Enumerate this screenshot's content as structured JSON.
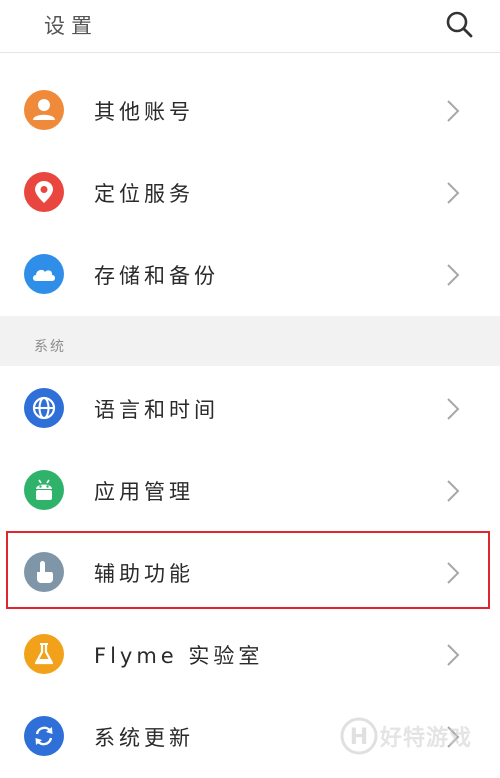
{
  "header": {
    "title": "设置",
    "search_icon": "search-icon"
  },
  "items_top": [
    {
      "label": "其他账号",
      "icon": "person-icon",
      "color": "#f08a3b"
    },
    {
      "label": "定位服务",
      "icon": "location-pin-icon",
      "color": "#e8463f"
    },
    {
      "label": "存储和备份",
      "icon": "cloud-icon",
      "color": "#2f8fe8"
    }
  ],
  "section": {
    "label": "系统"
  },
  "items_system": [
    {
      "label": "语言和时间",
      "icon": "globe-icon",
      "color": "#2e6fd8"
    },
    {
      "label": "应用管理",
      "icon": "android-icon",
      "color": "#2fb36a"
    },
    {
      "label": "辅助功能",
      "icon": "hand-pointer-icon",
      "color": "#7f96a8"
    },
    {
      "label": "Flyme 实验室",
      "icon": "flask-icon",
      "color": "#f2a21a"
    },
    {
      "label": "系统更新",
      "icon": "refresh-icon",
      "color": "#2e6fd8"
    }
  ],
  "highlight_color": "#e0272f",
  "watermark": {
    "text": "好特游戏"
  }
}
